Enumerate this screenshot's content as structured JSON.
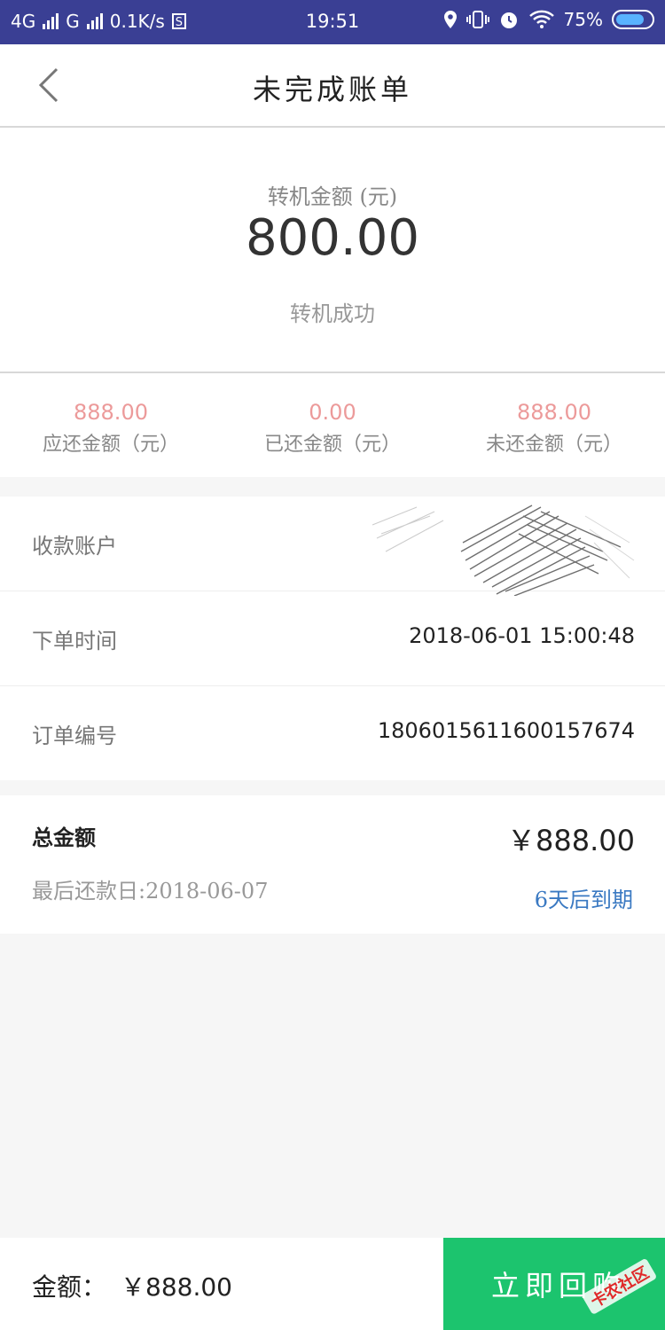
{
  "status_bar": {
    "network1": "4G",
    "network2": "G",
    "speed": "0.1K/s",
    "s_badge": "S",
    "time": "19:51",
    "battery": "75%"
  },
  "header": {
    "title": "未完成账单"
  },
  "summary": {
    "label": "转机金额 (元)",
    "amount": "800.00",
    "status": "转机成功"
  },
  "stats": [
    {
      "value": "888.00",
      "label": "应还金额（元）"
    },
    {
      "value": "0.00",
      "label": "已还金额（元）"
    },
    {
      "value": "888.00",
      "label": "未还金额（元）"
    }
  ],
  "details": {
    "account_label": "收款账户",
    "order_time_label": "下单时间",
    "order_time": "2018-06-01 15:00:48",
    "order_no_label": "订单编号",
    "order_no": "1806015611600157674"
  },
  "total": {
    "label": "总金额",
    "amount": "￥888.00",
    "due_date": "最后还款日:2018-06-07",
    "expire": "6天后到期"
  },
  "bottom": {
    "amount_label": "金额：",
    "amount": "￥888.00",
    "repay_button": "立即回购"
  },
  "colors": {
    "status_bar": "#3a3f94",
    "stat_value": "#ec9a9a",
    "expire": "#3a79c2",
    "repay_button": "#1cc46e"
  }
}
